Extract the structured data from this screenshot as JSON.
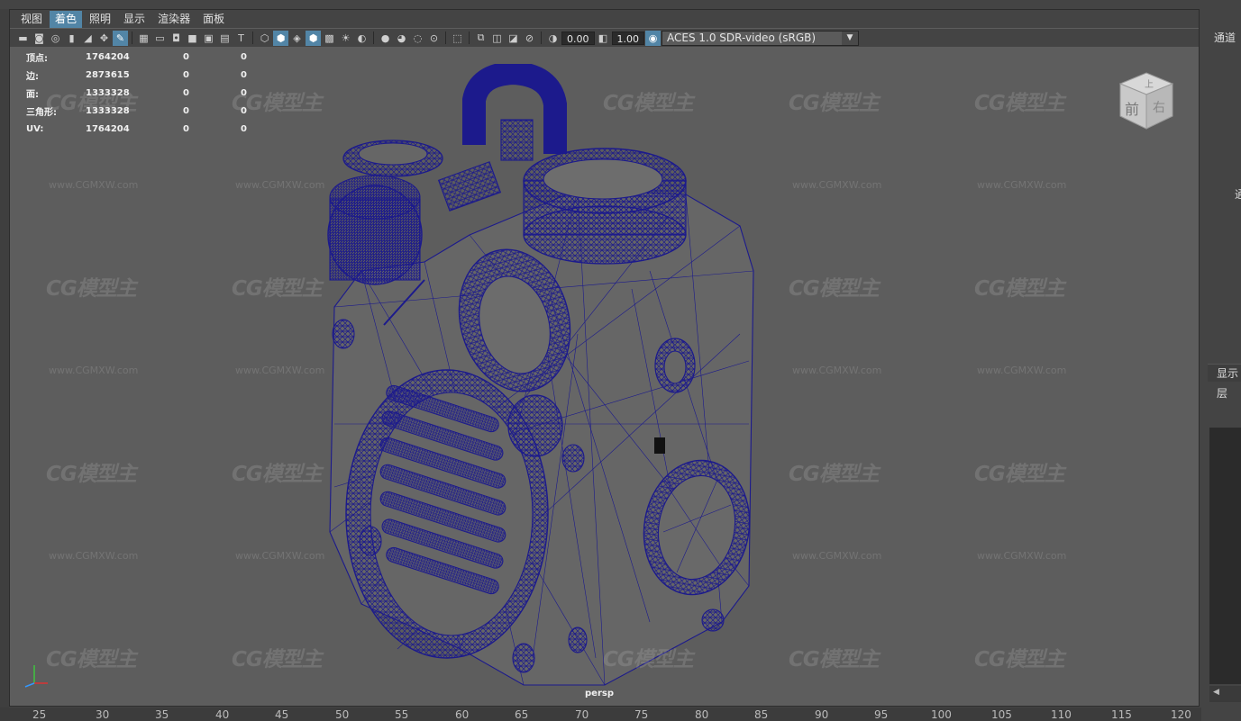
{
  "menu": {
    "items": [
      {
        "label": "视图"
      },
      {
        "label": "着色"
      },
      {
        "label": "照明"
      },
      {
        "label": "显示"
      },
      {
        "label": "渲染器"
      },
      {
        "label": "面板"
      }
    ],
    "active_index": 1
  },
  "toolbar": {
    "exposure_value": "0.00",
    "gamma_value": "1.00",
    "color_space": "ACES 1.0 SDR-video (sRGB)"
  },
  "stats": [
    {
      "label": "顶点:",
      "v1": "1764204",
      "v2": "0",
      "v3": "0"
    },
    {
      "label": "边:",
      "v1": "2873615",
      "v2": "0",
      "v3": "0"
    },
    {
      "label": "面:",
      "v1": "1333328",
      "v2": "0",
      "v3": "0"
    },
    {
      "label": "三角形:",
      "v1": "1333328",
      "v2": "0",
      "v3": "0"
    },
    {
      "label": "UV:",
      "v1": "1764204",
      "v2": "0",
      "v3": "0"
    }
  ],
  "viewcube": {
    "top_label": "上",
    "front_label": "前",
    "right_label": "右"
  },
  "camera_label": "persp",
  "watermark": {
    "logo": "CG模型主",
    "url": "www.CGMXW.com"
  },
  "right_panel": {
    "channel_label": "通道",
    "clip_label": "通",
    "display_tab": "显示",
    "layer_label": "层"
  },
  "ruler": {
    "ticks": [
      "25",
      "30",
      "35",
      "40",
      "45",
      "50",
      "55",
      "60",
      "65",
      "70",
      "75",
      "80",
      "85",
      "90",
      "95",
      "100",
      "105",
      "110",
      "115",
      "120"
    ]
  },
  "colors": {
    "viewport_bg": "#5d5d5d",
    "wireframe": "#1c1a8c",
    "active_menu": "#5285a6"
  }
}
